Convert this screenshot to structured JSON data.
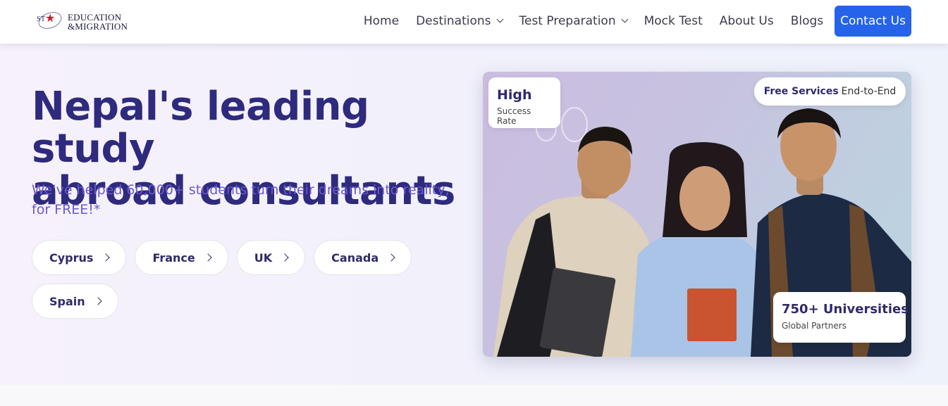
{
  "brand": {
    "logo_text_line1": "EDUCATION",
    "logo_text_line2": "&MIGRATION",
    "logo_mark": "STAR"
  },
  "nav": {
    "items": [
      {
        "label": "Home",
        "has_dropdown": false
      },
      {
        "label": "Destinations",
        "has_dropdown": true
      },
      {
        "label": "Test Preparation",
        "has_dropdown": true
      },
      {
        "label": "Mock Test",
        "has_dropdown": false
      },
      {
        "label": "About Us",
        "has_dropdown": false
      },
      {
        "label": "Blogs",
        "has_dropdown": false
      }
    ],
    "contact_label": "Contact Us"
  },
  "hero": {
    "headline_line1": "Nepal's leading study",
    "headline_line2": "abroad consultants",
    "subline": "We've helped 60,000+ students turn their dreams into reality, for FREE!*",
    "destinations": [
      "Cyprus",
      "France",
      "UK",
      "Canada",
      "Spain"
    ]
  },
  "photo_cards": {
    "high": {
      "big": "High",
      "small": "Success Rate"
    },
    "free": {
      "bold": "Free Services",
      "rest": "End-to-End"
    },
    "universities": {
      "big": "750+ Universities",
      "small": "Global Partners"
    }
  },
  "colors": {
    "primary": "#2563eb",
    "headline": "#2e2a7d",
    "subline": "#6a5bd0"
  }
}
